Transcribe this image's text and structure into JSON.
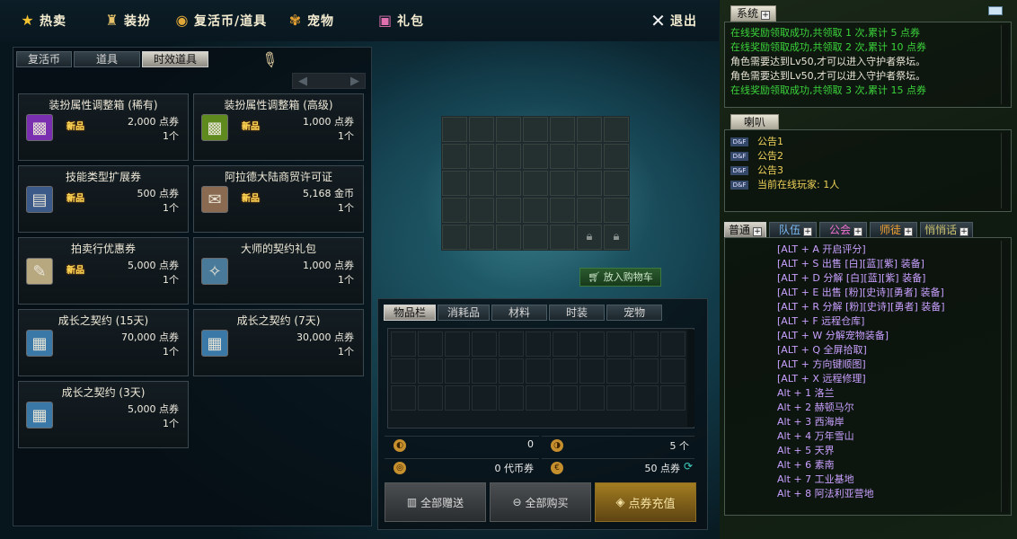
{
  "menu": {
    "hot": "热卖",
    "costume": "装扮",
    "currency": "复活币/道具",
    "pet": "宠物",
    "gift": "礼包",
    "exit": "退出"
  },
  "shop": {
    "tabs": [
      "复活币",
      "道具",
      "时效道具"
    ],
    "items": [
      {
        "name": "装扮属性调整箱 (稀有)",
        "price": "2,000 点券",
        "qty": "1个",
        "new": "新品",
        "icon": "purple-box-icon"
      },
      {
        "name": "装扮属性调整箱 (高级)",
        "price": "1,000 点券",
        "qty": "1个",
        "new": "新品",
        "icon": "green-box-icon"
      },
      {
        "name": "技能类型扩展券",
        "price": "500 点券",
        "qty": "1个",
        "new": "新品",
        "icon": "scroll-icon"
      },
      {
        "name": "阿拉德大陆商贸许可证",
        "price": "5,168 金币",
        "qty": "1个",
        "new": "新品",
        "icon": "permit-icon"
      },
      {
        "name": "拍卖行优惠券",
        "price": "5,000 点券",
        "qty": "1个",
        "new": "新品",
        "icon": "coupon-icon"
      },
      {
        "name": "大师的契约礼包",
        "price": "1,000 点券",
        "qty": "1个",
        "new": "",
        "icon": "contract-pack-icon"
      },
      {
        "name": "成长之契约 (15天)",
        "price": "70,000 点券",
        "qty": "1个",
        "new": "",
        "icon": "contract-icon"
      },
      {
        "name": "成长之契约 (7天)",
        "price": "30,000 点券",
        "qty": "1个",
        "new": "",
        "icon": "contract-icon"
      },
      {
        "name": "成长之契约 (3天)",
        "price": "5,000 点券",
        "qty": "1个",
        "new": "",
        "icon": "contract-icon"
      }
    ]
  },
  "cart_button": "放入购物车",
  "inventory": {
    "tabs": [
      "物品栏",
      "消耗品",
      "材料",
      "时装",
      "宠物"
    ],
    "currencies": {
      "c1": "0",
      "c2": "5 个",
      "c3": "0 代币券",
      "c4": "50 点券"
    },
    "buttons": {
      "gift_all": "全部赠送",
      "buy_all": "全部购买",
      "recharge": "点券充值"
    }
  },
  "system": {
    "tab": "系统",
    "lines": [
      {
        "t": "在线奖励领取成功,共领取 1 次,累计 5 点券",
        "c": "g"
      },
      {
        "t": "在线奖励领取成功,共领取 2 次,累计 10 点券",
        "c": "g"
      },
      {
        "t": "角色需要达到Lv50,才可以进入守护者祭坛。",
        "c": "w"
      },
      {
        "t": "角色需要达到Lv50,才可以进入守护者祭坛。",
        "c": "w"
      },
      {
        "t": "在线奖励领取成功,共领取 3 次,累计 15 点券",
        "c": "g"
      }
    ]
  },
  "horn": {
    "tab": "喇叭",
    "lines": [
      "公告1",
      "公告2",
      "公告3",
      "当前在线玩家: 1人"
    ],
    "badge": "D&F"
  },
  "chat": {
    "tabs": [
      "普通",
      "队伍",
      "公会",
      "师徒",
      "悄悄话"
    ],
    "lines": [
      "[ALT + A   开启评分]",
      "[ALT + S   出售 [白][蓝][紫] 装备]",
      "[ALT + D   分解 [白][蓝][紫] 装备]",
      "[ALT + E   出售 [粉][史诗][勇者] 装备]",
      "[ALT + R   分解 [粉][史诗][勇者] 装备]",
      "[ALT + F   远程仓库]",
      "[ALT + W   分解宠物装备]",
      "[ALT + Q   全屏拾取]",
      "[ALT + 方向键顺图]",
      "[ALT + X 远程修理]",
      "Alt + 1   洛兰",
      "Alt + 2   赫顿马尔",
      "Alt + 3   西海岸",
      "Alt + 4   万年雪山",
      "Alt + 5   天界",
      "Alt + 6   素南",
      "Alt + 7   工业基地",
      "Alt + 8   阿法利亚营地"
    ]
  }
}
